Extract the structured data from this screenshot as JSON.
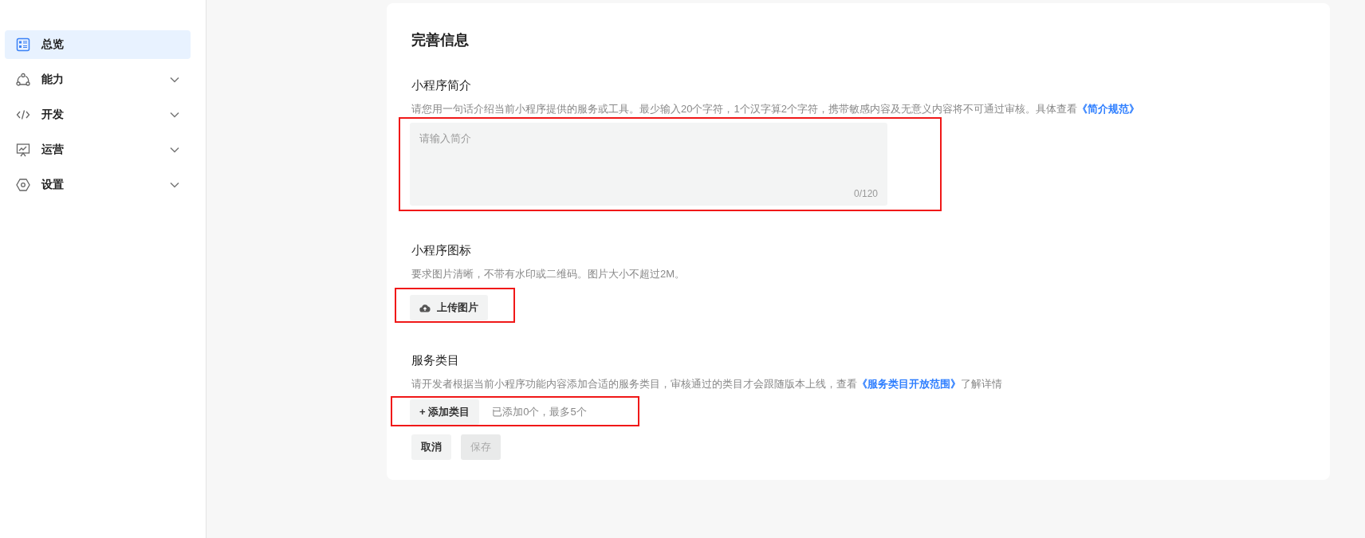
{
  "sidebar": {
    "items": [
      {
        "label": "总览",
        "kind": "link",
        "selected": true
      },
      {
        "label": "能力",
        "kind": "group",
        "selected": false,
        "expanded": false
      },
      {
        "label": "开发",
        "kind": "group",
        "selected": false,
        "expanded": false
      },
      {
        "label": "运营",
        "kind": "group",
        "selected": false,
        "expanded": false
      },
      {
        "label": "设置",
        "kind": "group",
        "selected": false,
        "expanded": false
      }
    ]
  },
  "card": {
    "title": "完善信息",
    "sections": [
      {
        "kind": "textarea",
        "label": "小程序简介",
        "hint": "请您用一句话介绍当前小程序提供的服务或工具。最少输入20个字符，1个汉字算2个字符，携带敏感内容及无意义内容将不可通过审核。具体查看",
        "link": "《简介规范》",
        "placeholder": "请输入简介",
        "counter": "0/120",
        "annotated": true
      },
      {
        "kind": "upload",
        "label": "小程序图标",
        "hint": "要求图片清晰，不带有水印或二维码。图片大小不超过2M。",
        "button": "上传图片",
        "annotated": true
      },
      {
        "kind": "category",
        "label": "服务类目",
        "hint": "请开发者根据当前小程序功能内容添加合适的服务类目，审核通过的类目才会跟随版本上线，查看",
        "link": "《服务类目开放范围》",
        "hint_after": "了解详情",
        "button": "+ 添加类目",
        "note": "已添加0个，最多5个",
        "annotated": true
      }
    ],
    "buttons": [
      {
        "label": "取消",
        "disabled": false
      },
      {
        "label": "保存",
        "disabled": true
      }
    ]
  }
}
